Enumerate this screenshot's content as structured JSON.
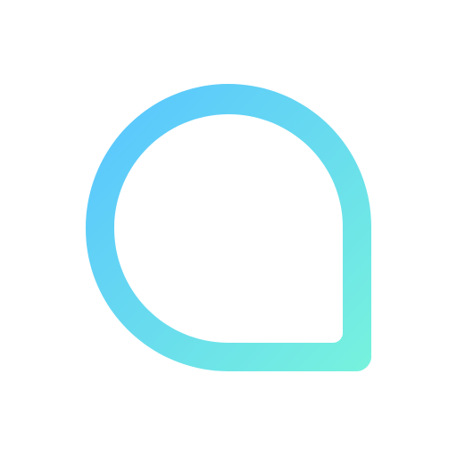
{
  "logo": {
    "icon": "speech-bubble-icon",
    "colors": {
      "gradient_start": "#5BC8FD",
      "gradient_end": "#76F1DE",
      "background": "#FFFFFF"
    }
  }
}
